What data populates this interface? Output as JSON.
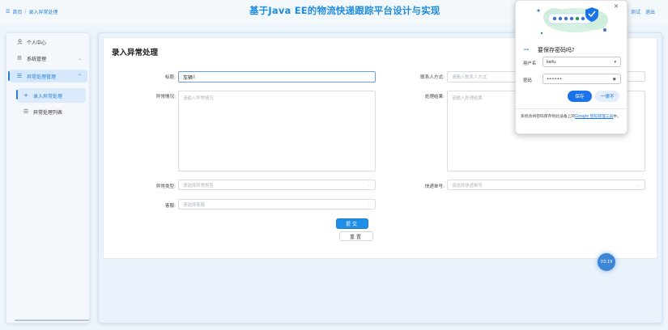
{
  "header": {
    "breadcrumb_home": "首页",
    "breadcrumb_sep": "/",
    "breadcrumb_current": "录入异常处理",
    "title": "基于Java EE的物流快递跟踪平台设计与实现",
    "right_links": [
      "测试",
      "退出"
    ],
    "home_icon": "menu-icon"
  },
  "sidebar": {
    "items": [
      {
        "label": "个人中心",
        "icon": "person-icon"
      },
      {
        "label": "系统管理",
        "icon": "gear-icon",
        "chevron": "chevron-down-icon"
      },
      {
        "label": "异常处理管理",
        "icon": "list-icon",
        "chevron": "chevron-up-icon",
        "expanded": true
      },
      {
        "label": "录入异常处理",
        "icon": "plus-icon",
        "active": true
      },
      {
        "label": "异常处理列表",
        "icon": "list-icon"
      }
    ]
  },
  "form": {
    "page_title": "录入异常处理",
    "fields": {
      "title_label": "标题:",
      "title_value": "车辆",
      "contact_label": "联系人方式:",
      "contact_placeholder": "请输入联系人方式",
      "situation_label": "异常情况:",
      "situation_placeholder": "请输入异常情况",
      "result_label": "处理结果:",
      "result_placeholder": "请输入处理结果",
      "type_label": "异常类型:",
      "type_placeholder": "请选择异常类型",
      "tracking_label": "快递单号:",
      "tracking_placeholder": "请选择快递单号",
      "service_label": "客服:",
      "service_placeholder": "请选择客服"
    },
    "submit_label": "提交",
    "reset_label": "重置"
  },
  "fab_label": "03:19",
  "password_popup": {
    "title": "要保存密码吗?",
    "username_label": "用户名",
    "username_value": "kefu",
    "password_label": "密码",
    "password_value": "••••••",
    "save_label": "保存",
    "never_label": "一律不",
    "footer_text": "系统会将密码保存到此设备上的",
    "footer_link": "Google 密码管理工具",
    "footer_end": "中。",
    "accent": "#1a73e8"
  },
  "colors": {
    "brand": "#1e8be0",
    "sidebar_active_bg": "#d5e8fb",
    "submit_bg": "#1f8ee6"
  }
}
